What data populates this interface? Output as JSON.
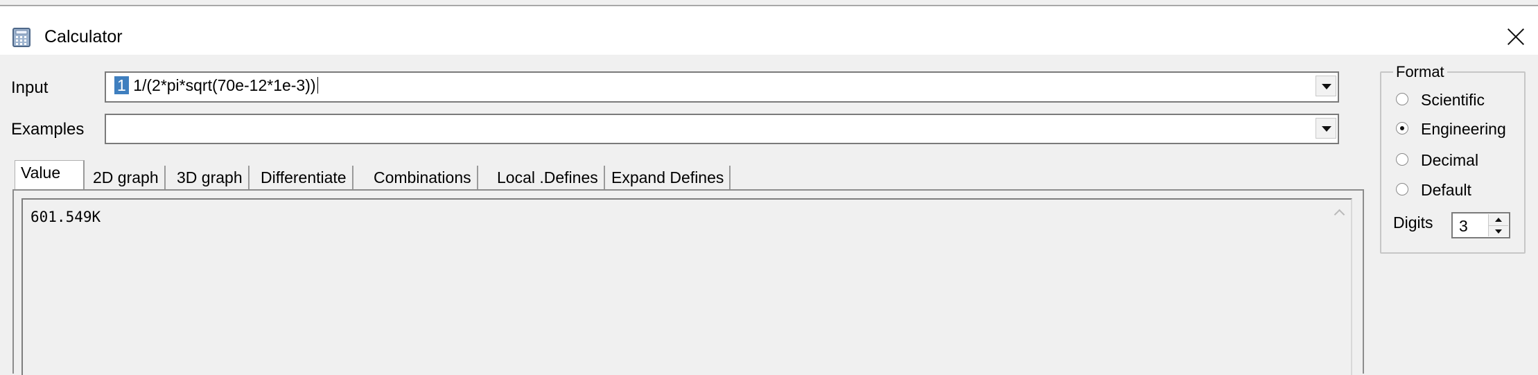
{
  "window": {
    "title": "Calculator",
    "icon": "calculator-icon",
    "close_icon": "close-icon"
  },
  "input": {
    "label": "Input",
    "selected_text": "1",
    "value": "1/(2*pi*sqrt(70e-12*1e-3))"
  },
  "examples": {
    "label": "Examples",
    "value": ""
  },
  "tabs": [
    {
      "label": "Value",
      "active": true
    },
    {
      "label": "2D graph",
      "active": false
    },
    {
      "label": "3D graph",
      "active": false
    },
    {
      "label": "Differentiate",
      "active": false
    },
    {
      "label": "Combinations",
      "active": false
    },
    {
      "label": "Local .Defines",
      "active": false
    },
    {
      "label": "Expand Defines",
      "active": false
    }
  ],
  "result": {
    "value": "601.549K"
  },
  "format": {
    "legend": "Format",
    "options": [
      {
        "label": "Scientific",
        "selected": false
      },
      {
        "label": "Engineering",
        "selected": true
      },
      {
        "label": "Decimal",
        "selected": false
      },
      {
        "label": "Default",
        "selected": false
      }
    ],
    "digits_label": "Digits",
    "digits_value": "3"
  },
  "colors": {
    "selection": "#3f7fbf",
    "window_bg": "#f0f0f0",
    "title_bg": "#ffffff"
  }
}
